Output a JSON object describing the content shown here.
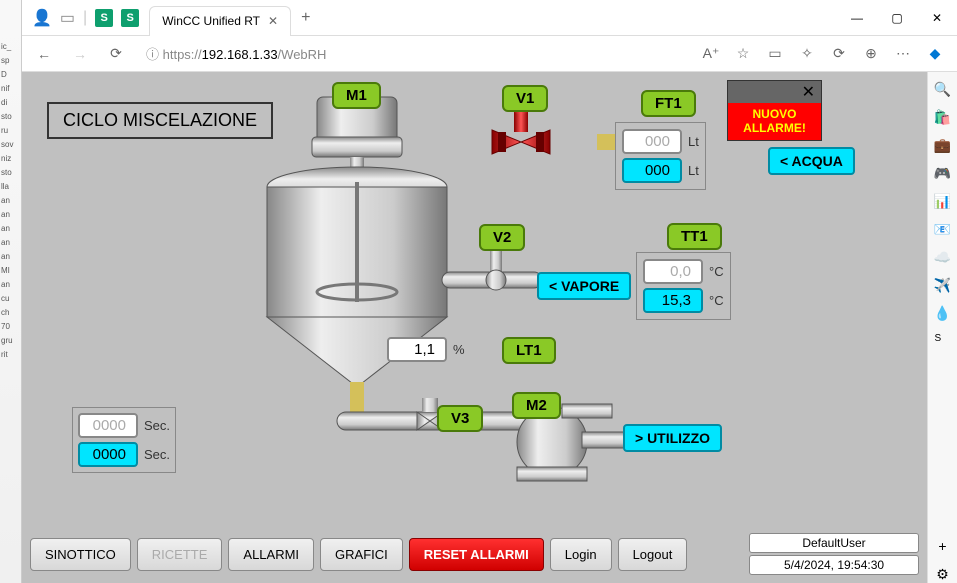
{
  "browser": {
    "tab_title": "WinCC Unified RT",
    "url_host": "192.168.1.33",
    "url_path": "/WebRH"
  },
  "scada": {
    "title": "CICLO MISCELAZIONE",
    "tags": {
      "m1": "M1",
      "v1": "V1",
      "ft1": "FT1",
      "v2": "V2",
      "tt1": "TT1",
      "lt1": "LT1",
      "v3": "V3",
      "m2": "M2"
    },
    "flows": {
      "acqua": "< ACQUA",
      "vapore": "< VAPORE",
      "utilizzo": "> UTILIZZO"
    },
    "ft1": {
      "sp": "000",
      "pv": "000",
      "unit": "Lt"
    },
    "tt1": {
      "sp": "0,0",
      "pv": "15,3",
      "unit": "°C"
    },
    "lt1": {
      "pv": "1,1",
      "unit": "%"
    },
    "timers": {
      "sp": "0000",
      "pv": "0000",
      "unit": "Sec."
    },
    "alarm": {
      "line1": "NUOVO",
      "line2": "ALLARME!"
    },
    "buttons": {
      "sinottico": "SINOTTICO",
      "ricette": "RICETTE",
      "allarmi": "ALLARMI",
      "grafici": "GRAFICI",
      "reset": "RESET ALLARMI",
      "login": "Login",
      "logout": "Logout"
    },
    "status": {
      "user": "DefaultUser",
      "datetime": "5/4/2024, 19:54:30"
    }
  }
}
